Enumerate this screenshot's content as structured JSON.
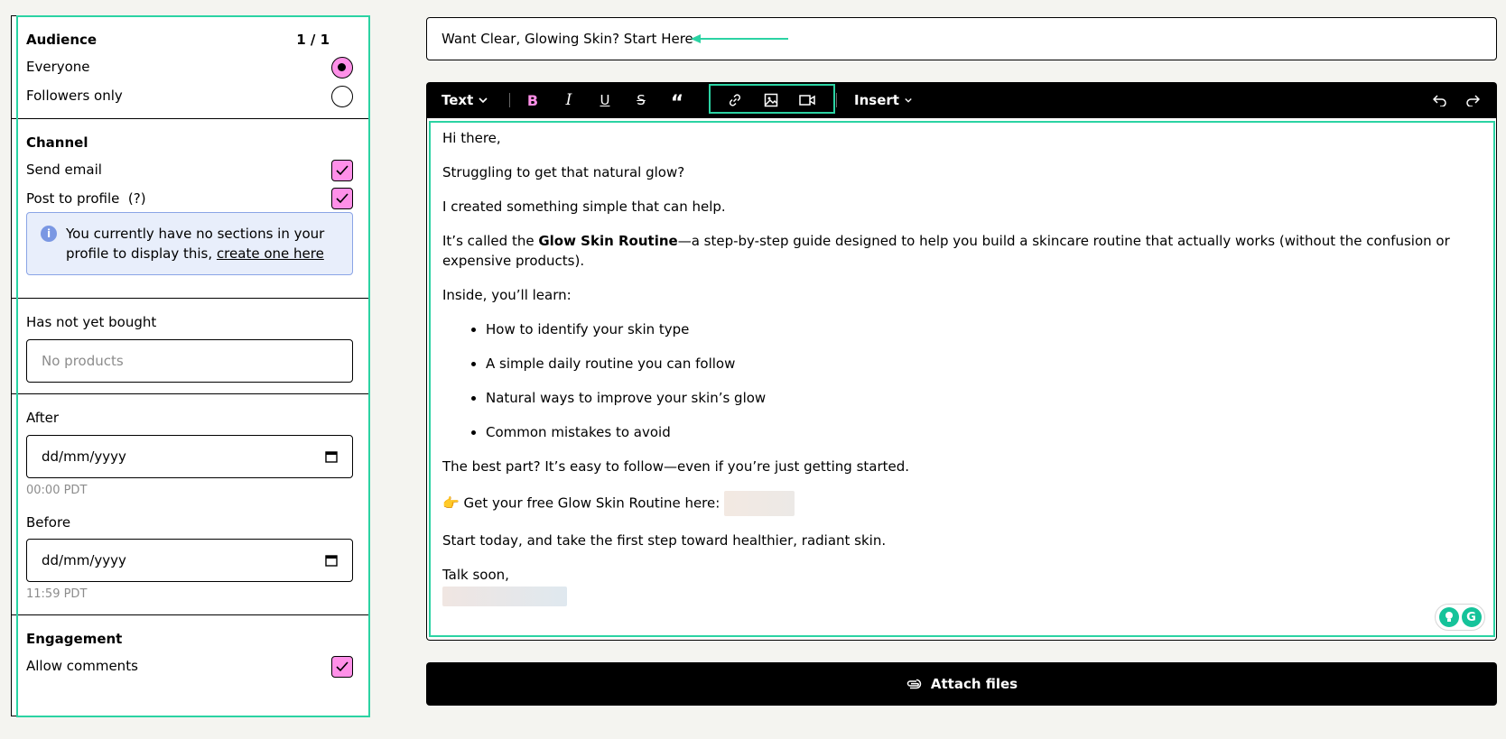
{
  "audience": {
    "heading": "Audience",
    "count": "1 / 1",
    "options": [
      {
        "label": "Everyone",
        "selected": true
      },
      {
        "label": "Followers only",
        "selected": false
      }
    ]
  },
  "channel": {
    "heading": "Channel",
    "send_email": {
      "label": "Send email",
      "checked": true
    },
    "post_to_profile": {
      "label": "Post to profile",
      "help": "(?)",
      "checked": true
    },
    "info": {
      "text": "You currently have no sections in your profile to display this,",
      "link": "create one here"
    }
  },
  "filters": {
    "not_bought": {
      "label": "Has not yet bought",
      "placeholder": "No products"
    },
    "after": {
      "label": "After",
      "placeholder": "dd/mm/yyyy",
      "time": "00:00 PDT"
    },
    "before": {
      "label": "Before",
      "placeholder": "dd/mm/yyyy",
      "time": "11:59 PDT"
    }
  },
  "engagement": {
    "heading": "Engagement",
    "allow_comments": {
      "label": "Allow comments",
      "checked": true
    }
  },
  "subject": "Want Clear, Glowing Skin? Start Here",
  "toolbar": {
    "text_label": "Text",
    "insert_label": "Insert"
  },
  "email_body": {
    "greeting": "Hi there,",
    "p1": "Struggling to get that natural glow?",
    "p2": "I created something simple that can help.",
    "p3_prefix": "It’s called the ",
    "p3_bold": "Glow Skin Routine",
    "p3_suffix": "—a step-by-step guide designed to help you build a skincare routine that actually works (without the confusion or expensive products).",
    "p4": "Inside, you’ll learn:",
    "bullets": [
      "How to identify your skin type",
      "A simple daily routine you can follow",
      "Natural ways to improve your skin’s glow",
      "Common mistakes to avoid"
    ],
    "p5": "The best part? It’s easy to follow—even if you’re just getting started.",
    "p6_emoji": "👉",
    "p6": "Get your free Glow Skin Routine here:",
    "p7": "Start today, and take the first step toward healthier, radiant skin.",
    "signoff": "Talk soon,"
  },
  "attach_label": "Attach files",
  "colors": {
    "accent": "#ff90e8",
    "highlight": "#2bd3a3",
    "info_bg": "#e8eefb"
  }
}
